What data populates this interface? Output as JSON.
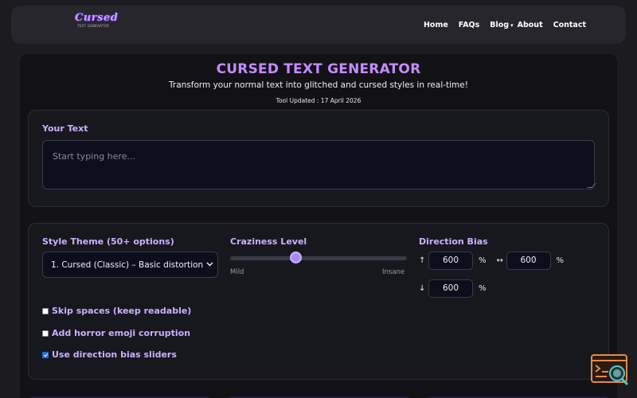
{
  "header": {
    "logo": {
      "word": "Cursed",
      "sub": "TEXT GENERATOR"
    },
    "nav": {
      "home": "Home",
      "faqs": "FAQs",
      "blog": "Blog",
      "about": "About",
      "contact": "Contact"
    }
  },
  "main": {
    "title": "CURSED TEXT GENERATOR",
    "subtitle": "Transform your normal text into glitched and cursed styles in real-time!",
    "updated": "Tool Updated : 17 April 2026"
  },
  "input": {
    "label": "Your Text",
    "placeholder": "Start typing here...",
    "value": ""
  },
  "options": {
    "style_label": "Style Theme (50+ options)",
    "style_selected": "1. Cursed (Classic) – Basic distortion",
    "craziness_label": "Craziness Level",
    "craziness_min": "Mild",
    "craziness_max": "Insane",
    "craziness_level": 0.36,
    "direction_label": "Direction Bias",
    "direction": {
      "up_arrow": "↑",
      "up_value": "600",
      "up_unit": "%",
      "side_arrow": "↔",
      "side_value": "600",
      "side_unit": "%",
      "down_arrow": "↓",
      "down_value": "600",
      "down_unit": "%"
    },
    "checkboxes": [
      {
        "label": "Skip spaces (keep readable)",
        "checked": false
      },
      {
        "label": "Add horror emoji corruption",
        "checked": false
      },
      {
        "label": "Use direction bias sliders",
        "checked": true
      }
    ]
  },
  "colors": {
    "accent": "#c38cff",
    "label": "#c9b2ff",
    "background": "#1b1b20",
    "panel": "#111116",
    "widget": "#e58a4a"
  },
  "icons": {
    "nav_caret": "▾",
    "select_chevron": "⌄",
    "widget": "code-search-icon"
  }
}
